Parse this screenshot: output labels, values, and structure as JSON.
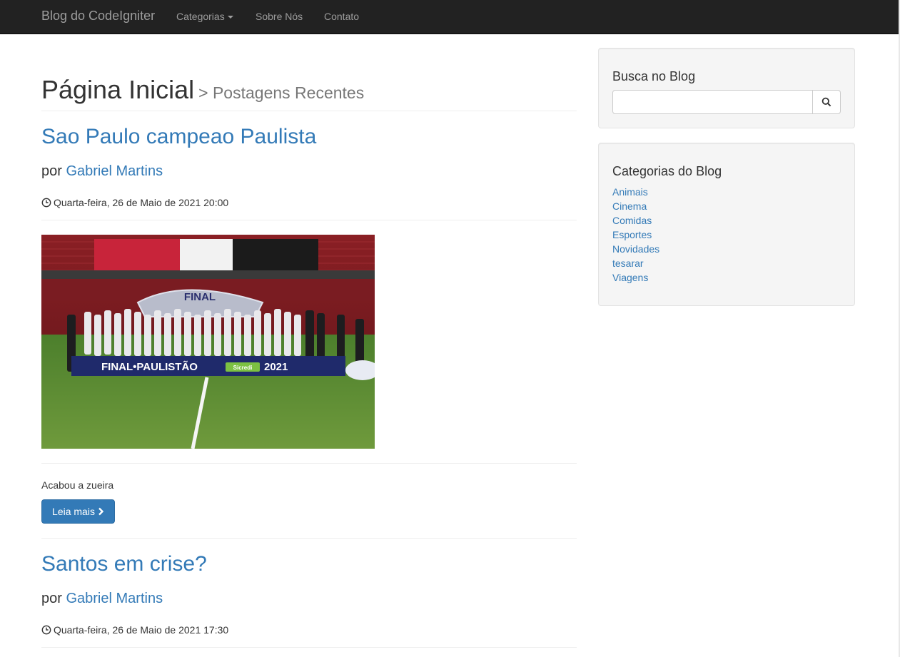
{
  "navbar": {
    "brand": "Blog do CodeIgniter",
    "items": [
      "Categorias",
      "Sobre Nós",
      "Contato"
    ]
  },
  "header": {
    "title": "Página Inicial",
    "subtitle": "> Postagens Recentes"
  },
  "posts": [
    {
      "title": "Sao Paulo campeao Paulista",
      "by": "por",
      "author": "Gabriel Martins",
      "date": "Quarta-feira, 26 de Maio de 2021 20:00",
      "excerpt": "Acabou a zueira",
      "read_more": "Leia mais",
      "image": {
        "banner_text": "FINAL",
        "board_text": "FINAL•PAULISTÃO",
        "board_year": "2021",
        "sponsor": "Sicredi"
      }
    },
    {
      "title": "Santos em crise?",
      "by": "por",
      "author": "Gabriel Martins",
      "date": "Quarta-feira, 26 de Maio de 2021 17:30"
    }
  ],
  "sidebar": {
    "search": {
      "title": "Busca no Blog",
      "placeholder": ""
    },
    "categories": {
      "title": "Categorias do Blog",
      "items": [
        "Animais",
        "Cinema",
        "Comidas",
        "Esportes",
        "Novidades",
        "tesarar",
        "Viagens"
      ]
    }
  },
  "colors": {
    "link": "#337ab7",
    "navbar": "#222222",
    "well": "#f5f5f5",
    "button": "#337ab7"
  }
}
